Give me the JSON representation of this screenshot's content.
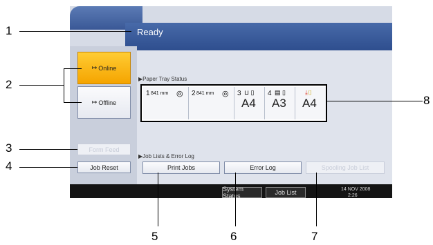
{
  "header": {
    "title": "Ready"
  },
  "left_panel": {
    "online_label": "Online",
    "offline_label": "Offline",
    "form_feed_label": "Form Feed",
    "job_reset_label": "Job Reset"
  },
  "paper_tray": {
    "label": "Paper Tray Status",
    "trays": [
      {
        "number": "1",
        "size": "841 mm",
        "paper": ""
      },
      {
        "number": "2",
        "size": "841 mm",
        "paper": ""
      },
      {
        "number": "3",
        "size": "",
        "paper": "A4"
      },
      {
        "number": "4",
        "size": "",
        "paper": "A3"
      },
      {
        "number": "",
        "size": "",
        "paper": "A4"
      }
    ]
  },
  "job_lists": {
    "label": "Job Lists & Error Log",
    "print_jobs_label": "Print Jobs",
    "error_log_label": "Error Log",
    "spooling_job_list_label": "Spooling Job List"
  },
  "bottom_bar": {
    "system_status_label": "System Status",
    "job_list_label": "Job List",
    "date": "14 NOV  2008",
    "time": "2:26"
  },
  "callouts": [
    "1",
    "2",
    "3",
    "4",
    "5",
    "6",
    "7",
    "8"
  ],
  "colors": {
    "header_blue": "#3a5896",
    "online_orange": "#f5a400",
    "screen_bg": "#d6dbe6",
    "bottom_bar": "#141414"
  }
}
